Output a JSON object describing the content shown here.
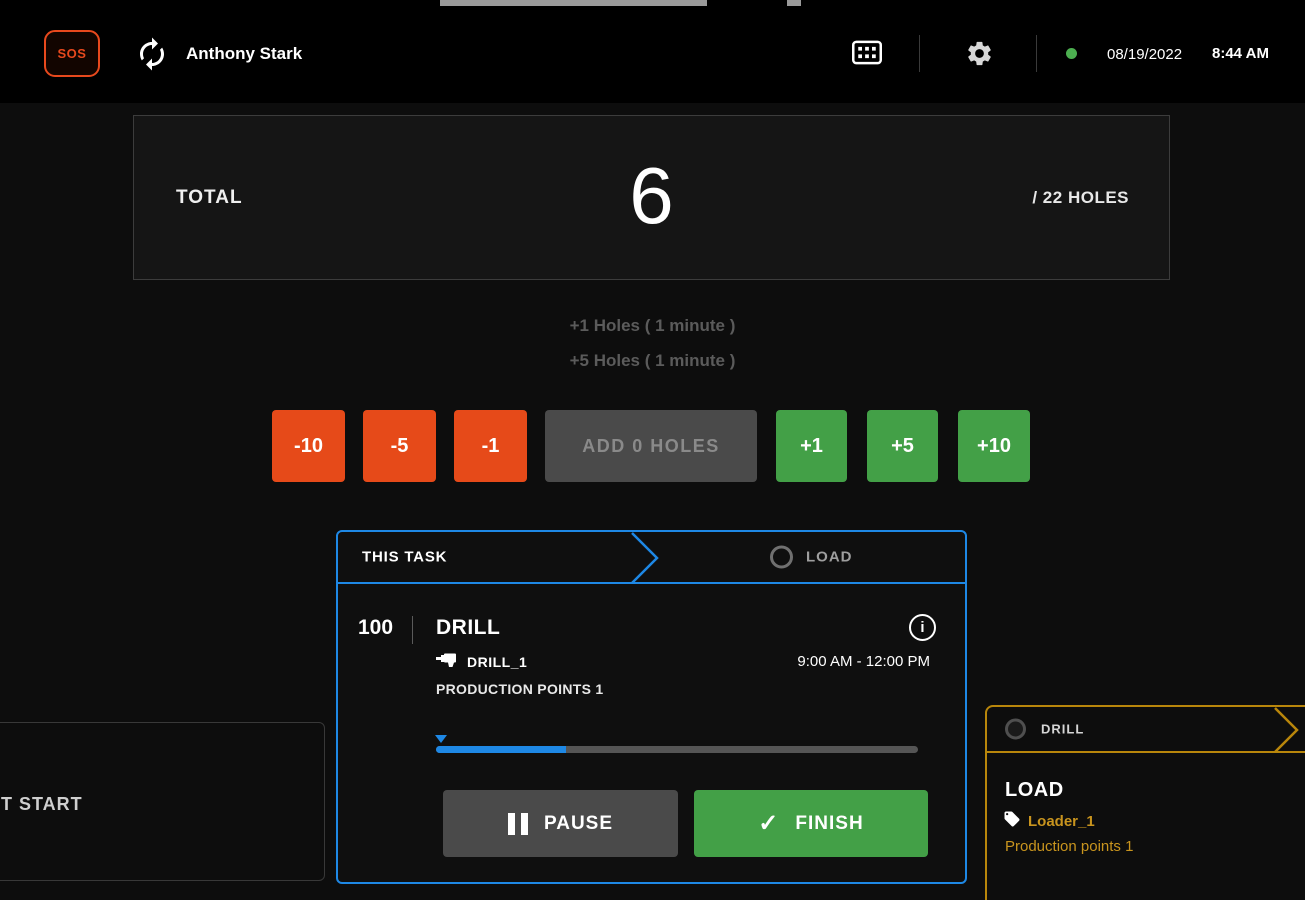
{
  "colors": {
    "accent_blue": "#1e88e5",
    "action_red": "#e64a19",
    "action_green": "#43a047",
    "amber": "#b8860b",
    "status_online_green": "#4caf50"
  },
  "topbar": {
    "sos_label": "SOS",
    "user_name": "Anthony Stark",
    "date": "08/19/2022",
    "time": "8:44 AM"
  },
  "hole_counter": {
    "label": "TOTAL",
    "value": "6",
    "capacity": "/ 22 HOLES",
    "pending": [
      "+1 Holes ( 1 minute )",
      "+5 Holes ( 1 minute )"
    ],
    "buttons": {
      "minus_10": "-10",
      "minus_5": "-5",
      "minus_1": "-1",
      "add": "ADD 0 HOLES",
      "plus_1": "+1",
      "plus_5": "+5",
      "plus_10": "+10"
    }
  },
  "current_task_card": {
    "header": "THIS TASK",
    "next_task": "LOAD",
    "task_number": "100",
    "task_name": "DRILL",
    "machine_name": "DRILL_1",
    "time_range": "9:00 AM - 12:00 PM",
    "production_points": "PRODUCTION POINTS 1",
    "progress_percent": 27,
    "info_glyph": "i",
    "pause_label": "PAUSE",
    "finish_label": "FINISH",
    "check_glyph": "✓"
  },
  "previous_task_card": {
    "label": "T START"
  },
  "next_task_card": {
    "header": "DRILL",
    "task_name": "LOAD",
    "machine_name": "Loader_1",
    "production_points": "Production points 1"
  }
}
